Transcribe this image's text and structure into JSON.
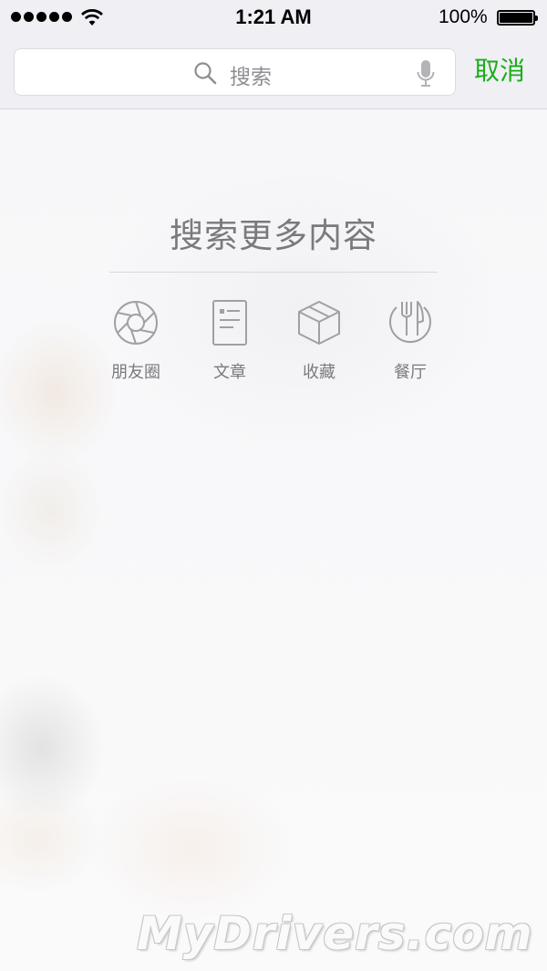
{
  "status_bar": {
    "time": "1:21 AM",
    "battery_percent": "100%",
    "signal_bars": 5,
    "wifi_icon": "wifi-icon",
    "battery_icon": "battery-icon"
  },
  "search": {
    "placeholder": "搜索",
    "search_icon": "search-icon",
    "mic_icon": "microphone-icon",
    "cancel_label": "取消"
  },
  "main": {
    "title": "搜索更多内容",
    "categories": [
      {
        "label": "朋友圈",
        "icon": "aperture-icon"
      },
      {
        "label": "文章",
        "icon": "document-icon"
      },
      {
        "label": "收藏",
        "icon": "cube-icon"
      },
      {
        "label": "餐厅",
        "icon": "fork-knife-icon"
      }
    ]
  },
  "watermark": "MyDrivers.com",
  "colors": {
    "accent": "#1aad19",
    "header_bg": "#efeff4",
    "icon_gray": "#a0a0a4",
    "text_gray": "#7a7a7e"
  }
}
